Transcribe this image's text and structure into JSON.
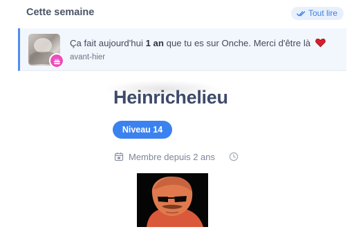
{
  "header": {
    "title": "Cette semaine",
    "mark_all_label": "Tout lire"
  },
  "notification": {
    "text_before": "Ça fait aujourd'hui ",
    "text_bold": "1 an",
    "text_after": " que tu es sur Onche. Merci d'être là",
    "time": "avant-hier",
    "badge_icon": "cake-icon",
    "emoji_icon": "heart-icon",
    "accent_color": "#4f8df0",
    "badge_color": "#ea4fbf"
  },
  "profile": {
    "username": "Heinrichelieu",
    "level": "Niveau 14",
    "member_since": "Membre depuis 2 ans",
    "level_color": "#3b82f0"
  }
}
